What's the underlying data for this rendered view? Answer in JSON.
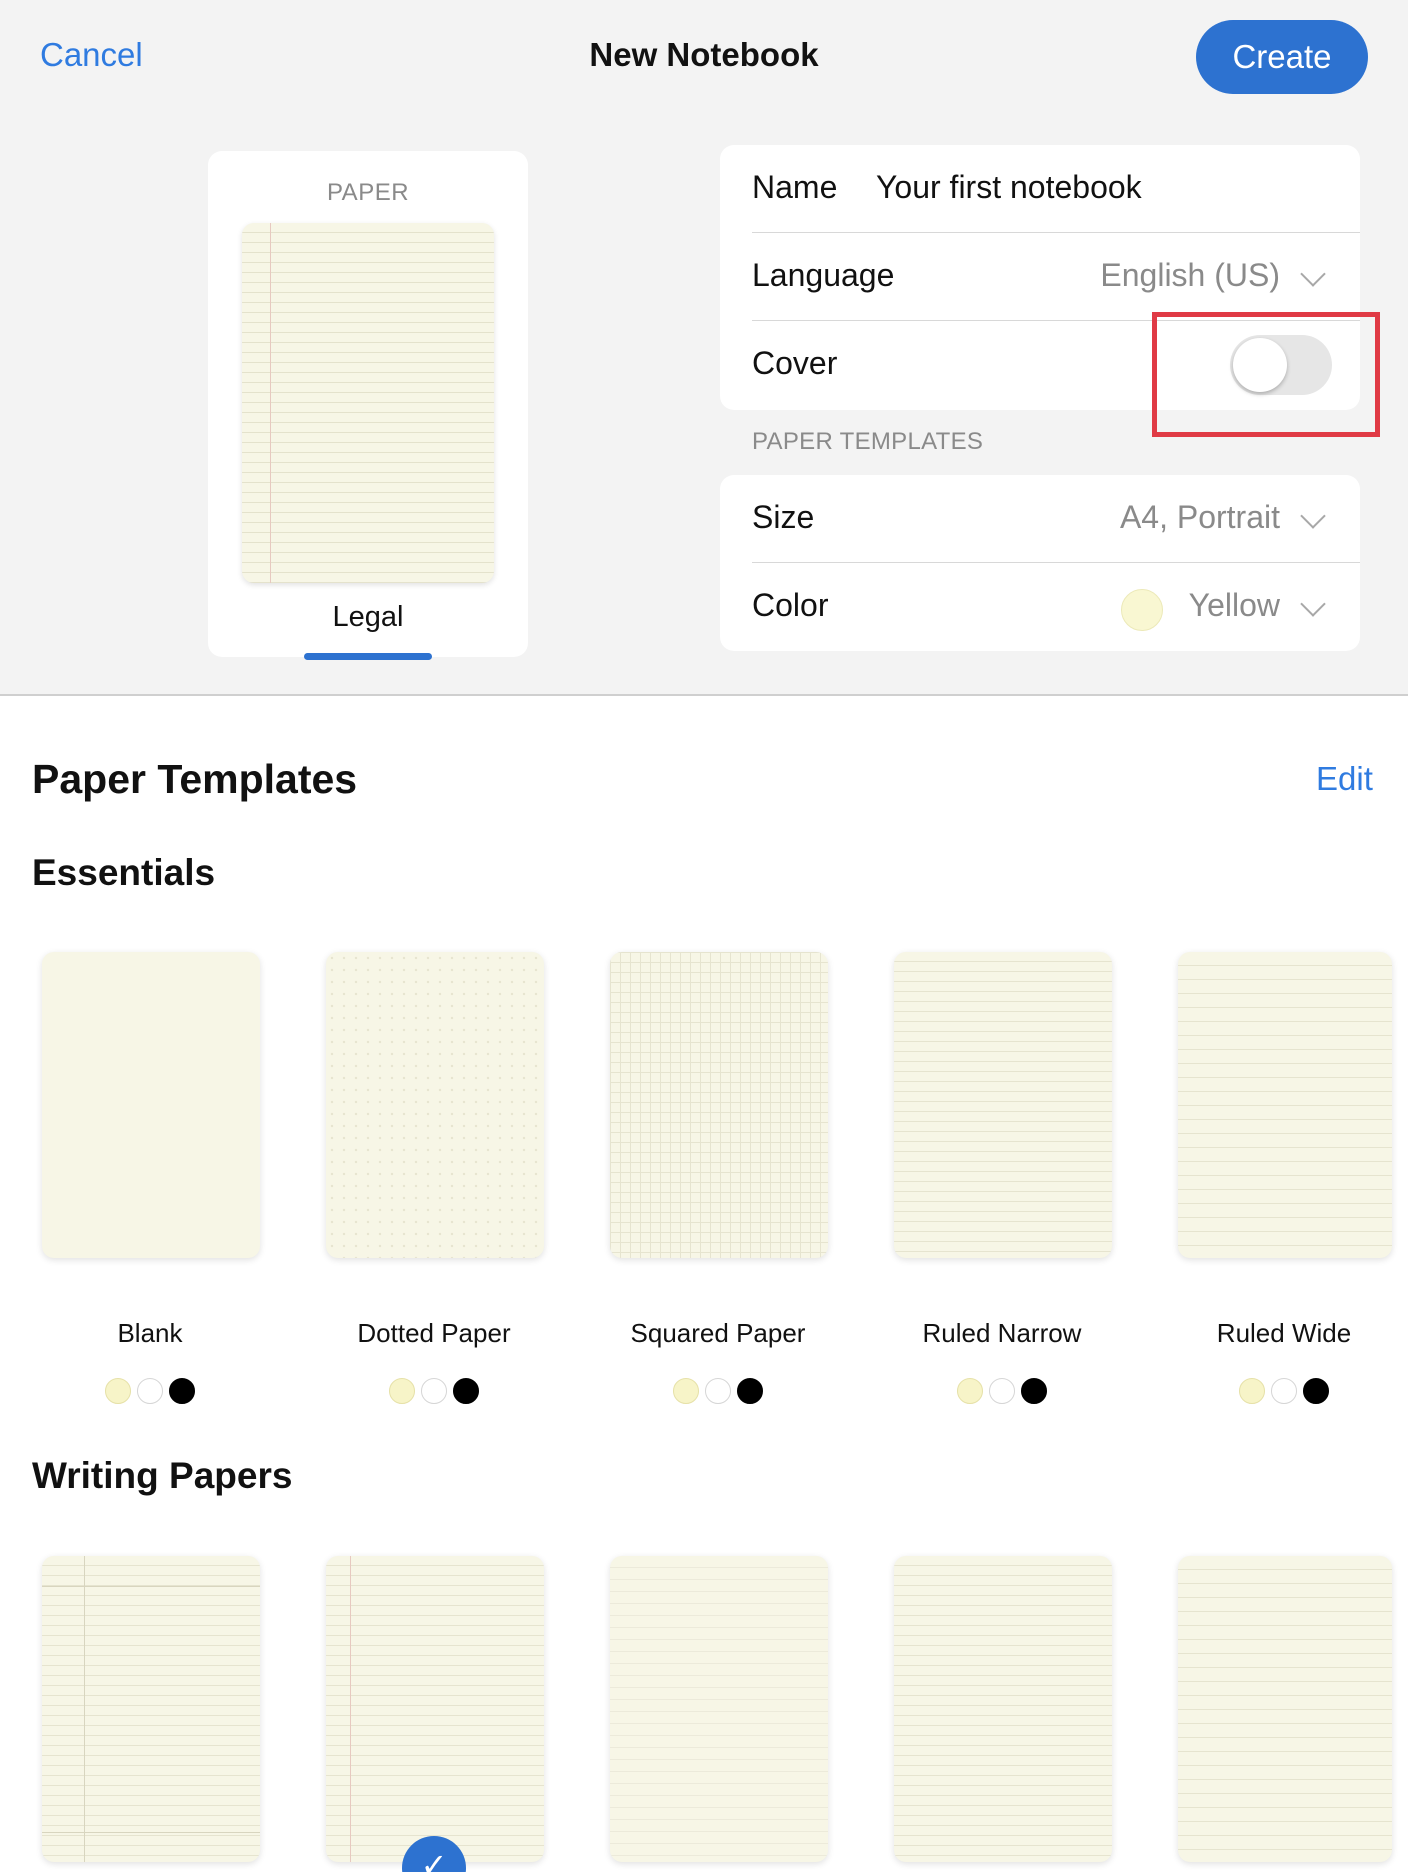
{
  "header": {
    "cancel_label": "Cancel",
    "title": "New Notebook",
    "create_label": "Create"
  },
  "paper_preview": {
    "caption": "PAPER",
    "selected_label": "Legal"
  },
  "settings": {
    "name_label": "Name",
    "name_value": "Your first notebook",
    "language_label": "Language",
    "language_value": "English (US)",
    "cover_label": "Cover",
    "cover_enabled": false,
    "templates_caption": "PAPER TEMPLATES",
    "size_label": "Size",
    "size_value": "A4, Portrait",
    "color_label": "Color",
    "color_value": "Yellow",
    "color_swatch": "#f9f7d2"
  },
  "templates": {
    "heading": "Paper Templates",
    "edit_label": "Edit",
    "essentials_heading": "Essentials",
    "essentials": [
      {
        "name": "Blank"
      },
      {
        "name": "Dotted Paper"
      },
      {
        "name": "Squared Paper"
      },
      {
        "name": "Ruled Narrow"
      },
      {
        "name": "Ruled Wide"
      }
    ],
    "writing_heading": "Writing Papers",
    "color_options": [
      "#f7f4c8",
      "#ffffff",
      "#000000"
    ]
  },
  "colors": {
    "accent": "#2d72d0",
    "link": "#2f7be0",
    "highlight": "#e03a45"
  }
}
